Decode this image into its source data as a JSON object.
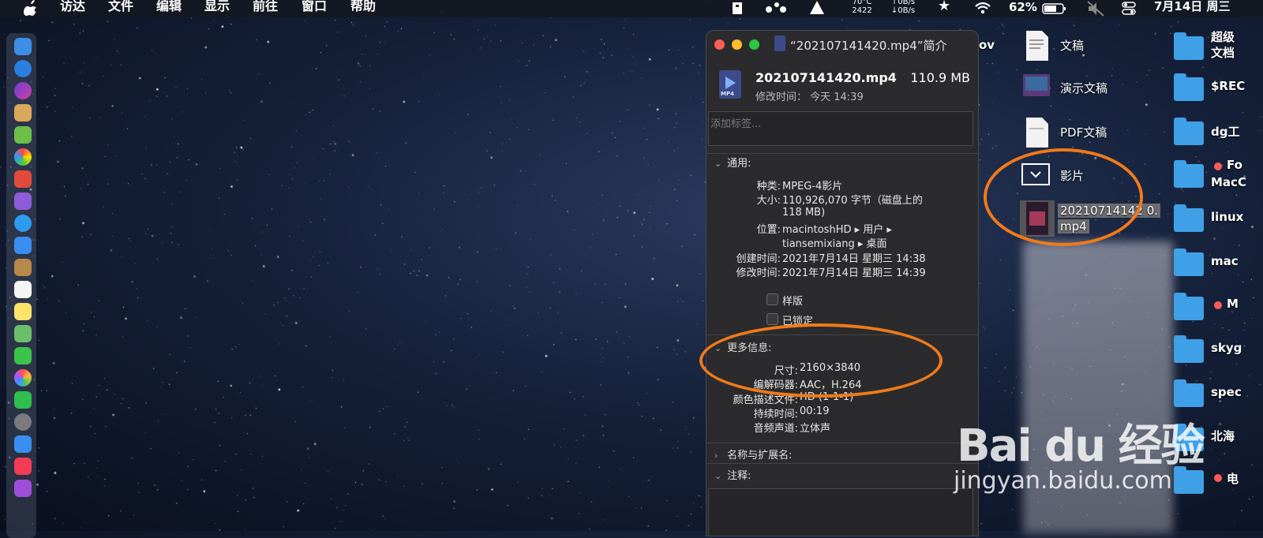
{
  "menubar": {
    "items": [
      "访达",
      "文件",
      "编辑",
      "显示",
      "前往",
      "窗口",
      "帮助"
    ],
    "net_top": "70°C",
    "net_mid": "2422",
    "up_speed": "↑0B/s",
    "down_speed": "↓0B/s",
    "battery": "62%",
    "date": "7月14日 周三"
  },
  "info_window": {
    "title": "“202107141420.mp4”简介",
    "file_name": "202107141420.mp4",
    "file_size": "110.9 MB",
    "modified_short": "修改时间： 今天 14:39",
    "tags_placeholder": "添加标签...",
    "file_icon_tag": "MP4",
    "general_title": "通用:",
    "general": {
      "kind_label": "种类:",
      "kind_value": "MPEG-4影片",
      "size_label": "大小:",
      "size_value_1": "110,926,070 字节（磁盘上的",
      "size_value_2": "118 MB)",
      "location_label": "位置:",
      "location_value_1": "macintoshHD ▸ 用户 ▸",
      "location_value_2": "tiansemixiang ▸ 桌面",
      "created_label": "创建时间:",
      "created_value": "2021年7月14日 星期三 14:38",
      "modified_label": "修改时间:",
      "modified_value": "2021年7月14日 星期三 14:39",
      "stationery_label": "样版",
      "locked_label": "已锁定"
    },
    "more_info_title": "更多信息:",
    "more_info": {
      "dimensions_label": "尺寸:",
      "dimensions_value": "2160×3840",
      "codecs_label": "编解码器:",
      "codecs_value": "AAC，H.264",
      "color_label": "颜色描述文件:",
      "color_value": "HD (1-1-1)",
      "duration_label": "持续时间:",
      "duration_value": "00:19",
      "audio_label": "音频声道:",
      "audio_value": "立体声"
    },
    "name_ext_title": "名称与扩展名:",
    "comments_title": "注释:"
  },
  "desktop": {
    "partial_text": "ov",
    "files": [
      {
        "label": "文稿"
      },
      {
        "label": "演示文稿"
      },
      {
        "label": "PDF文稿"
      },
      {
        "label": "影片"
      },
      {
        "label_line1": "20210714142 0.",
        "label_line2": "mp4"
      }
    ],
    "folders": [
      {
        "label_line1": "超级",
        "label_line2": "文档"
      },
      {
        "label": "$REC"
      },
      {
        "label": "dg工"
      },
      {
        "label_line1": "Fo",
        "label_line2": "MacC"
      },
      {
        "label": "linux"
      },
      {
        "label": "mac"
      },
      {
        "label": "M"
      },
      {
        "label": "skyg"
      },
      {
        "label": "spec"
      },
      {
        "label": "北海"
      },
      {
        "label": "电"
      }
    ]
  },
  "watermark": {
    "logo": "Bai du 经验",
    "url": "jingyan.baidu.com"
  },
  "colors": {
    "highlight_oval": "#f07a1a",
    "folder": "#3fa0e8",
    "window_bg": "#2b2b2d"
  }
}
